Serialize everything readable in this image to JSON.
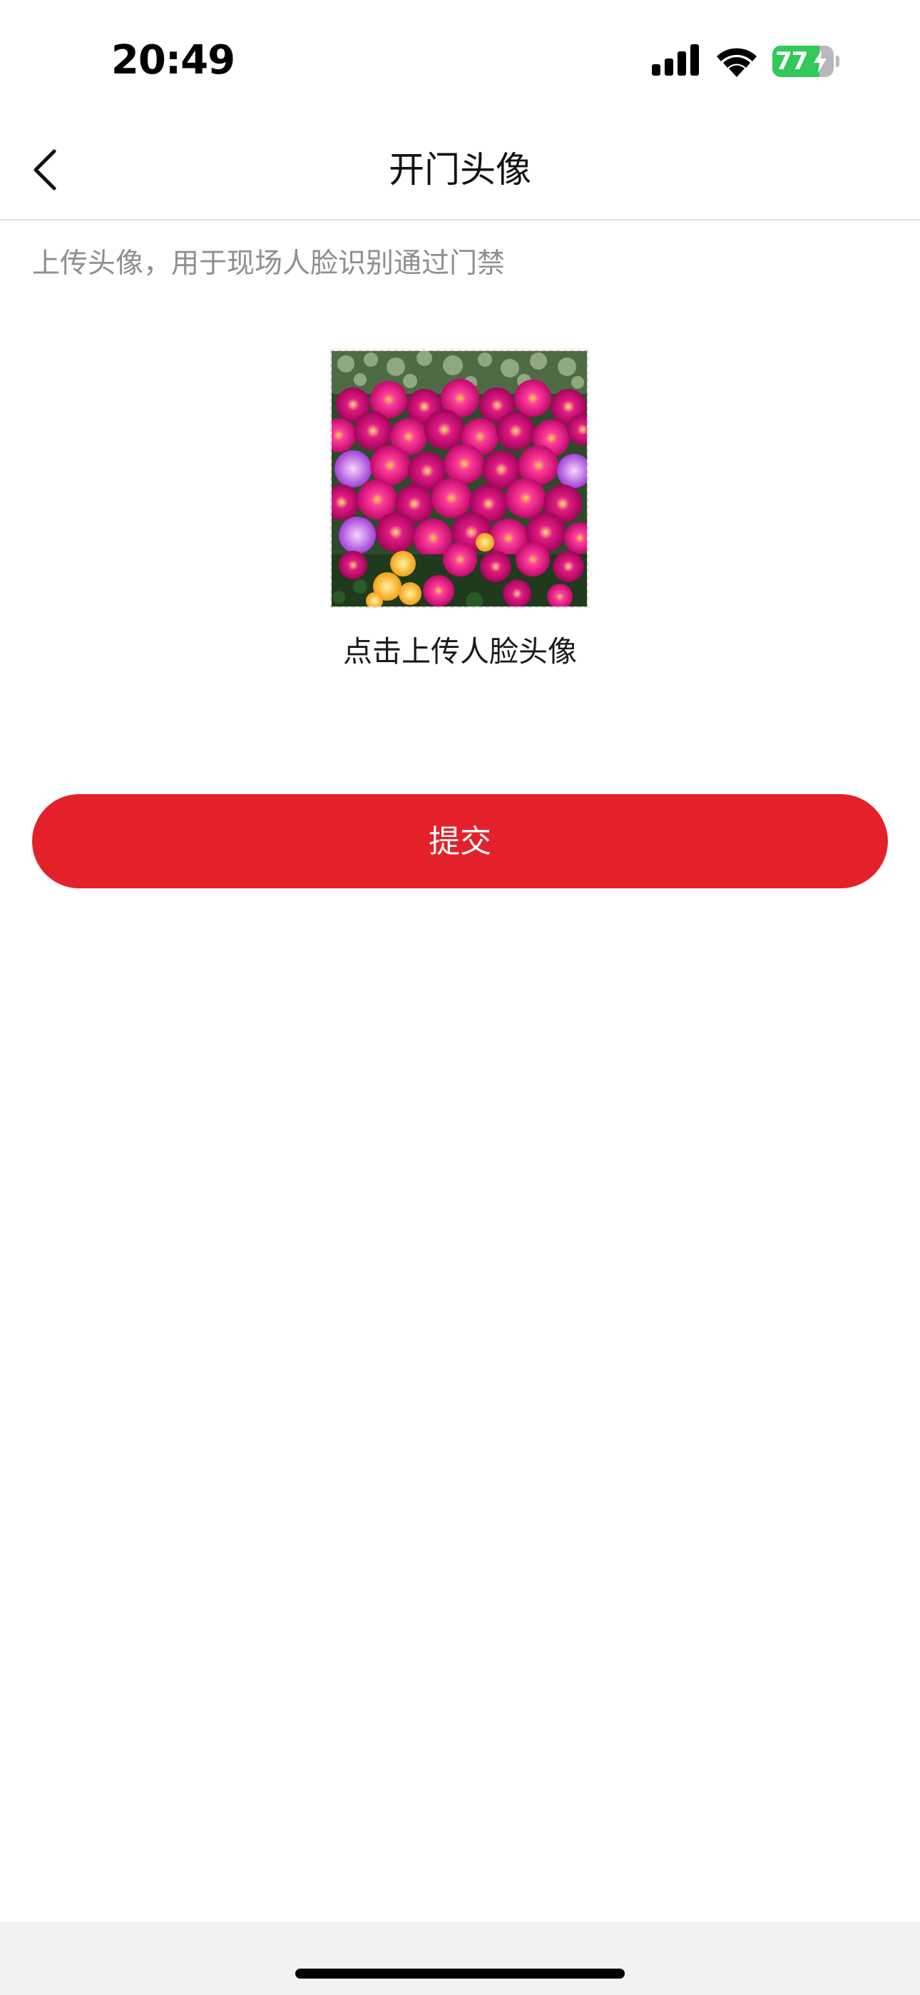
{
  "status_bar": {
    "time": "20:49",
    "battery_level": "77",
    "battery_charging": true,
    "icons": [
      "signal-icon",
      "wifi-icon",
      "battery-icon",
      "bolt-icon"
    ]
  },
  "nav": {
    "title": "开门头像",
    "back_icon": "chevron-left-icon"
  },
  "page": {
    "description": "上传头像，用于现场人脸识别通过门禁",
    "upload_caption": "点击上传人脸头像",
    "submit_label": "提交"
  },
  "colors": {
    "accent": "#e4212b",
    "battery": "#34c759",
    "secondary_text": "#8e8e93"
  }
}
